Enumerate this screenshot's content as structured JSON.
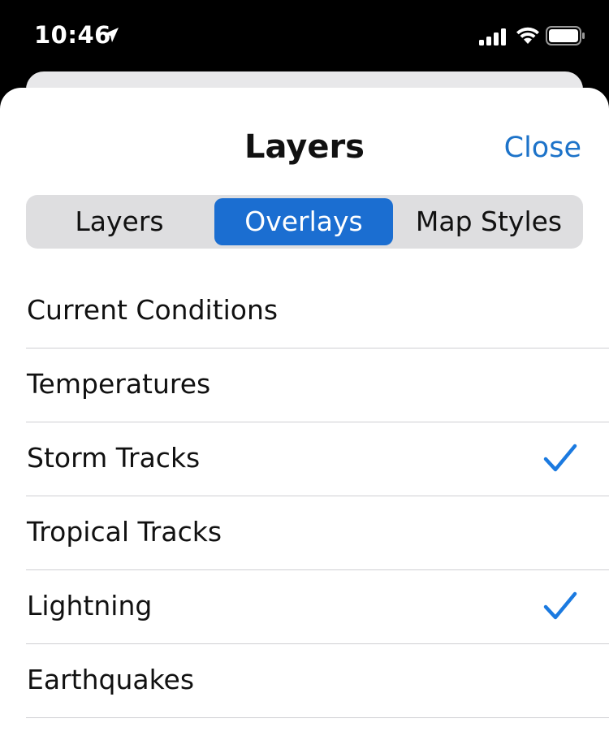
{
  "status_bar": {
    "time": "10:46"
  },
  "sheet": {
    "title": "Layers",
    "close_label": "Close"
  },
  "segmented_control": {
    "segments": [
      "Layers",
      "Overlays",
      "Map Styles"
    ],
    "selected": "Overlays"
  },
  "overlays": {
    "items": [
      {
        "label": "Current Conditions",
        "checked": false
      },
      {
        "label": "Temperatures",
        "checked": false
      },
      {
        "label": "Storm Tracks",
        "checked": true
      },
      {
        "label": "Tropical Tracks",
        "checked": false
      },
      {
        "label": "Lightning",
        "checked": true
      },
      {
        "label": "Earthquakes",
        "checked": false
      }
    ]
  },
  "colors": {
    "accent": "#1b6ed1",
    "link": "#1d73c9",
    "check": "#1b7ae0"
  },
  "icons": {
    "location": "location-arrow-icon",
    "signal": "cellular-signal-icon",
    "wifi": "wifi-icon",
    "battery": "battery-icon",
    "check": "checkmark-icon"
  }
}
